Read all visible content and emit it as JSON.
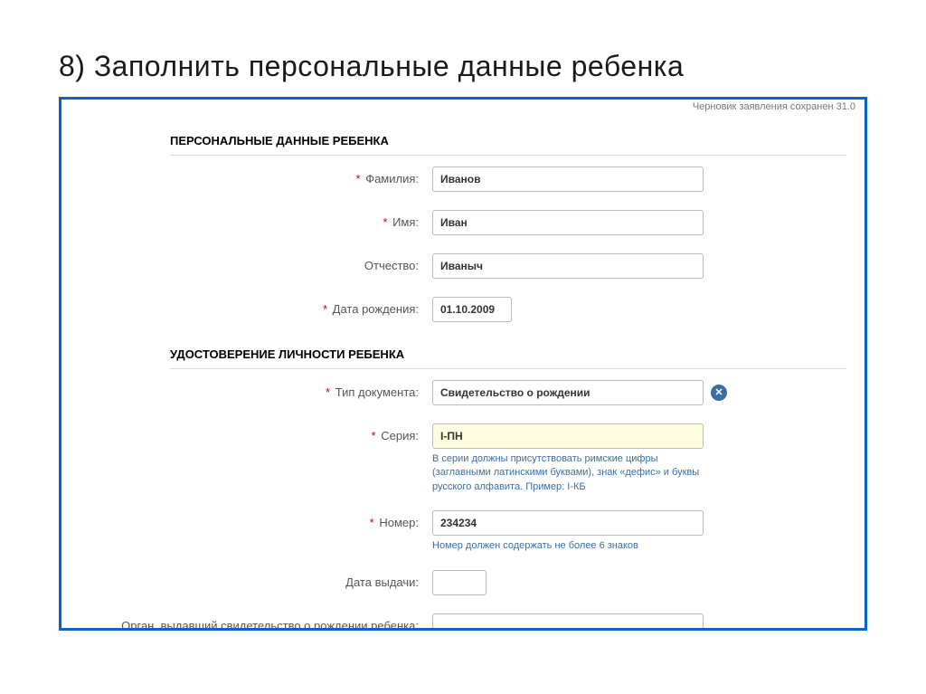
{
  "slide": {
    "title": "8) Заполнить персональные данные ребенка"
  },
  "draft_note": "Черновик заявления сохранен 31.0",
  "sections": {
    "personal": {
      "header": "ПЕРСОНАЛЬНЫЕ ДАННЫЕ РЕБЕНКА",
      "surname": {
        "label": "Фамилия:",
        "value": "Иванов"
      },
      "name": {
        "label": "Имя:",
        "value": "Иван"
      },
      "patronymic": {
        "label": "Отчество:",
        "value": "Иваныч"
      },
      "dob": {
        "label": "Дата рождения:",
        "value": "01.10.2009"
      }
    },
    "identity": {
      "header": "УДОСТОВЕРЕНИЕ ЛИЧНОСТИ РЕБЕНКА",
      "doc_type": {
        "label": "Тип документа:",
        "value": "Свидетельство о рождении"
      },
      "series": {
        "label": "Серия:",
        "value": "I-ПН",
        "hint": "В серии должны присутствовать римские цифры (заглавными латинскими буквами), знак «дефис» и буквы русского алфавита. Пример: I-КБ"
      },
      "number": {
        "label": "Номер:",
        "value": "234234",
        "hint": "Номер должен содержать не более 6 знаков"
      },
      "issue_date": {
        "label": "Дата выдачи:",
        "value": ""
      },
      "issuer": {
        "label": "Орган, выдавший свидетельство о рождении ребенка:",
        "value": ""
      }
    }
  },
  "required_mark": "*"
}
